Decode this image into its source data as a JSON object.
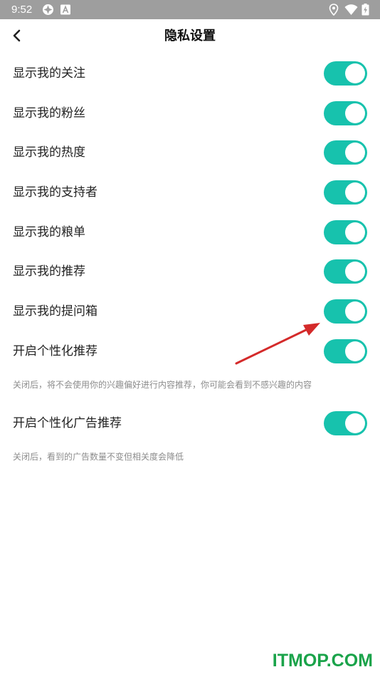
{
  "status_bar": {
    "time": "9:52",
    "left_icons": [
      "app-notification-icon",
      "a-letter-notification-icon"
    ],
    "right_icons": [
      "location-icon",
      "wifi-icon",
      "battery-charging-icon"
    ]
  },
  "header": {
    "title": "隐私设置",
    "back_icon": "chevron-left-icon"
  },
  "settings": [
    {
      "label": "显示我的关注",
      "enabled": true
    },
    {
      "label": "显示我的粉丝",
      "enabled": true
    },
    {
      "label": "显示我的热度",
      "enabled": true
    },
    {
      "label": "显示我的支持者",
      "enabled": true
    },
    {
      "label": "显示我的粮单",
      "enabled": true
    },
    {
      "label": "显示我的推荐",
      "enabled": true
    },
    {
      "label": "显示我的提问箱",
      "enabled": true
    },
    {
      "label": "开启个性化推荐",
      "enabled": true,
      "description": "关闭后，将不会使用你的兴趣偏好进行内容推荐，你可能会看到不感兴趣的内容"
    },
    {
      "label": "开启个性化广告推荐",
      "enabled": true,
      "description": "关闭后，看到的广告数量不变但相关度会降低"
    }
  ],
  "colors": {
    "toggle_on": "#17c2ad",
    "status_bar": "#9e9e9e",
    "annotation_arrow": "#d42a2a",
    "watermark": "#1aa34a"
  },
  "watermark": "ITMOP.COM"
}
